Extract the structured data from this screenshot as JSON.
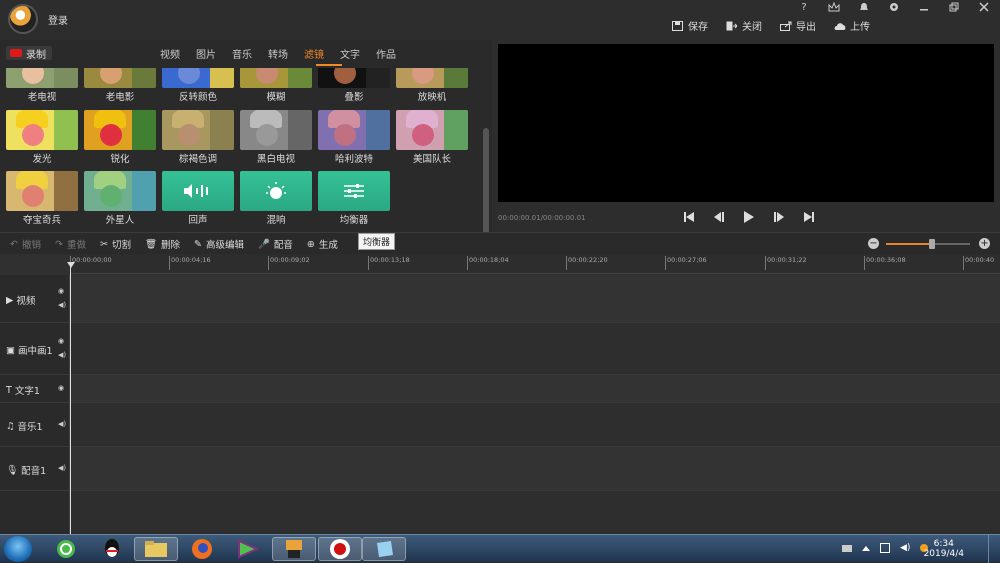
{
  "header": {
    "login": "登录",
    "actions": [
      {
        "icon": "save-icon",
        "label": "保存"
      },
      {
        "icon": "close-door-icon",
        "label": "关闭"
      },
      {
        "icon": "export-icon",
        "label": "导出"
      },
      {
        "icon": "cloud-upload-icon",
        "label": "上传"
      }
    ],
    "window_controls": [
      "help-icon",
      "crown-icon",
      "bell-icon",
      "settings-icon",
      "minimize-icon",
      "restore-icon",
      "close-icon"
    ],
    "help_glyph": "?"
  },
  "library": {
    "record_label": "录制",
    "tabs": [
      {
        "label": "视频",
        "active": false
      },
      {
        "label": "图片",
        "active": false
      },
      {
        "label": "音乐",
        "active": false
      },
      {
        "label": "转场",
        "active": false
      },
      {
        "label": "滤镜",
        "active": true
      },
      {
        "label": "文字",
        "active": false
      },
      {
        "label": "作品",
        "active": false
      }
    ],
    "effects_row1": [
      "老电视",
      "老电影",
      "反转颜色",
      "模糊",
      "叠影",
      "放映机"
    ],
    "effects_row2": [
      "发光",
      "锐化",
      "棕褐色调",
      "黑白电视",
      "哈利波特",
      "美国队长"
    ],
    "effects_row3": [
      "夺宝奇兵",
      "外星人",
      "回声",
      "混响",
      "均衡器"
    ]
  },
  "preview": {
    "timecode": "00:00:00.01/00:00:00.01",
    "controls": [
      "skip-start-icon",
      "prev-frame-icon",
      "play-icon",
      "next-frame-icon",
      "skip-end-icon"
    ]
  },
  "toolbar": {
    "undo": "撤销",
    "redo": "重做",
    "cut": "切割",
    "delete": "删除",
    "advanced_edit": "高级编辑",
    "dub": "配音",
    "partial_label": "生成",
    "tooltip": "均衡器",
    "zoom_level": 0.55
  },
  "ruler": {
    "ticks": [
      "00:00:00;00",
      "00:00:04;16",
      "00:00:09;02",
      "00:00:13;18",
      "00:00:18;04",
      "00:00:22;20",
      "00:00:27;06",
      "00:00:31;22",
      "00:00:36;08",
      "00:00:40"
    ]
  },
  "tracks": [
    {
      "name": "视频",
      "icon": "video-track-icon",
      "eye": true,
      "speaker": true
    },
    {
      "name": "画中画1",
      "icon": "pip-track-icon",
      "eye": true,
      "speaker": true
    },
    {
      "name": "文字1",
      "icon": "text-track-icon",
      "eye": true,
      "speaker": false
    },
    {
      "name": "音乐1",
      "icon": "music-track-icon",
      "eye": false,
      "speaker": true
    },
    {
      "name": "配音1",
      "icon": "mic-track-icon",
      "eye": false,
      "speaker": true
    }
  ],
  "taskbar": {
    "time": "6:34",
    "date": "2019/4/4"
  },
  "colors": {
    "accent": "#f28a2a",
    "record": "#e01818",
    "filter_green": "#35c197"
  }
}
